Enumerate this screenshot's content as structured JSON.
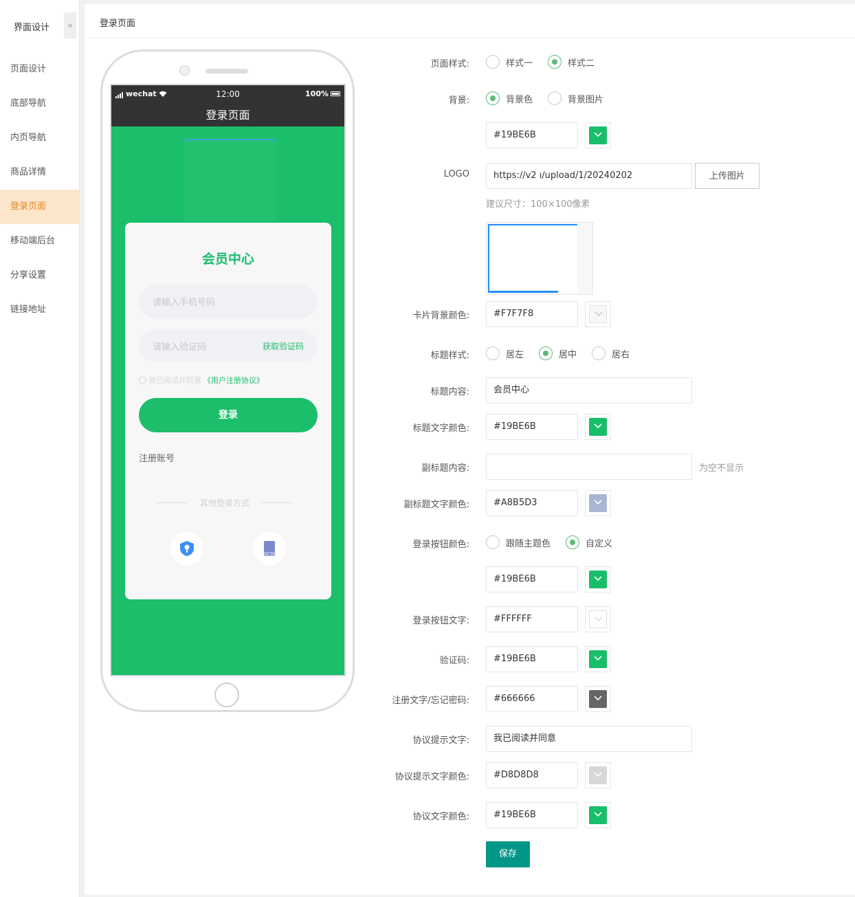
{
  "sidebar": {
    "title": "界面设计",
    "collapse_icon": "«",
    "items": [
      {
        "label": "页面设计"
      },
      {
        "label": "底部导航"
      },
      {
        "label": "内页导航"
      },
      {
        "label": "商品详情"
      },
      {
        "label": "登录页面",
        "active": true
      },
      {
        "label": "移动端后台"
      },
      {
        "label": "分享设置"
      },
      {
        "label": "链接地址"
      }
    ]
  },
  "header": {
    "title": "登录页面"
  },
  "preview": {
    "status_left": "wechat",
    "time": "12:00",
    "battery": "100%",
    "nav_title": "登录页面",
    "card_title": "会员中心",
    "phone_placeholder": "请输入手机号码",
    "code_placeholder": "请输入验证码",
    "get_code": "获取验证码",
    "agree_text": "我已阅读并同意",
    "protocol_text": "《用户注册协议》",
    "login_button": "登录",
    "register": "注册账号",
    "other_login": "其他登录方式",
    "icons": [
      "shield-key-icon",
      "tablet-icon"
    ]
  },
  "form": {
    "page_style": {
      "label": "页面样式:",
      "options": [
        "样式一",
        "样式二"
      ],
      "selected": 1
    },
    "background": {
      "label": "背景:",
      "options": [
        "背景色",
        "背景图片"
      ],
      "selected": 0,
      "color": "#19BE6B"
    },
    "logo": {
      "label": "LOGO",
      "value": "https://v2          ı/upload/1/20240202",
      "upload_button": "上传图片",
      "size_hint": "建议尺寸：100×100像素"
    },
    "card_bg": {
      "label": "卡片背景颜色:",
      "color": "#F7F7F8"
    },
    "title_style": {
      "label": "标题样式:",
      "options": [
        "居左",
        "居中",
        "居右"
      ],
      "selected": 1
    },
    "title_content": {
      "label": "标题内容:",
      "value": "会员中心"
    },
    "title_color": {
      "label": "标题文字颜色:",
      "color": "#19BE6B"
    },
    "subtitle_content": {
      "label": "副标题内容:",
      "value": "",
      "hint": "为空不显示"
    },
    "subtitle_color": {
      "label": "副标题文字颜色:",
      "color": "#A8B5D3"
    },
    "login_btn_color": {
      "label": "登录按钮颜色:",
      "options": [
        "跟随主题色",
        "自定义"
      ],
      "selected": 1,
      "color": "#19BE6B"
    },
    "login_btn_text": {
      "label": "登录按钮文字:",
      "color": "#FFFFFF"
    },
    "code_color": {
      "label": "验证码:",
      "color": "#19BE6B"
    },
    "register_color": {
      "label": "注册文字/忘记密码:",
      "color": "#666666"
    },
    "agree_text": {
      "label": "协议提示文字:",
      "value": "我已阅读并同意"
    },
    "agree_color": {
      "label": "协议提示文字颜色:",
      "color": "#D8D8D8"
    },
    "protocol_color": {
      "label": "协议文字颜色:",
      "color": "#19BE6B"
    },
    "save_button": "保存"
  }
}
